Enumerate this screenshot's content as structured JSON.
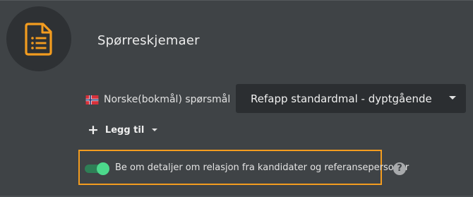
{
  "header": {
    "title": "Spørreskjemaer",
    "icon": "document-list-icon",
    "icon_color": "#f39c1f"
  },
  "language_row": {
    "flag": "norway-flag-icon",
    "label": "Norske(bokmål) spørsmål",
    "selected_template": "Refapp standardmal - dyptgående"
  },
  "add_button": {
    "label": "Legg til"
  },
  "relation_toggle": {
    "enabled": true,
    "label": "Be om detaljer om relasjon fra kandidater og referansepersoner",
    "highlight_color": "#f39c1f",
    "help_symbol": "?"
  }
}
